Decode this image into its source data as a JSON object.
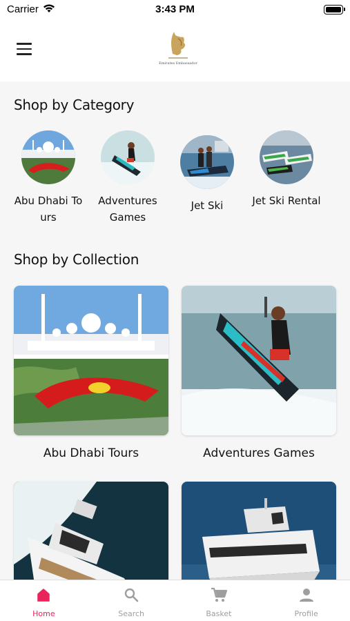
{
  "status_bar": {
    "carrier": "Carrier",
    "time": "3:43 PM"
  },
  "header": {
    "logo_text": "Emirates Embassador"
  },
  "sections": {
    "category_title": "Shop by Category",
    "collection_title": "Shop by Collection"
  },
  "categories": [
    {
      "label": "Abu Dhabi Tours"
    },
    {
      "label": "Adventures Games"
    },
    {
      "label": "Jet Ski"
    },
    {
      "label": "Jet Ski Rental"
    }
  ],
  "collections": [
    {
      "label": "Abu Dhabi Tours"
    },
    {
      "label": "Adventures Games"
    },
    {
      "label": ""
    },
    {
      "label": ""
    }
  ],
  "tabs": [
    {
      "label": "Home",
      "icon": "home-icon",
      "active": true
    },
    {
      "label": "Search",
      "icon": "search-icon",
      "active": false
    },
    {
      "label": "Basket",
      "icon": "cart-icon",
      "active": false
    },
    {
      "label": "Profile",
      "icon": "person-icon",
      "active": false
    }
  ],
  "colors": {
    "accent": "#e8245a",
    "inactive": "#9e9e9e"
  }
}
